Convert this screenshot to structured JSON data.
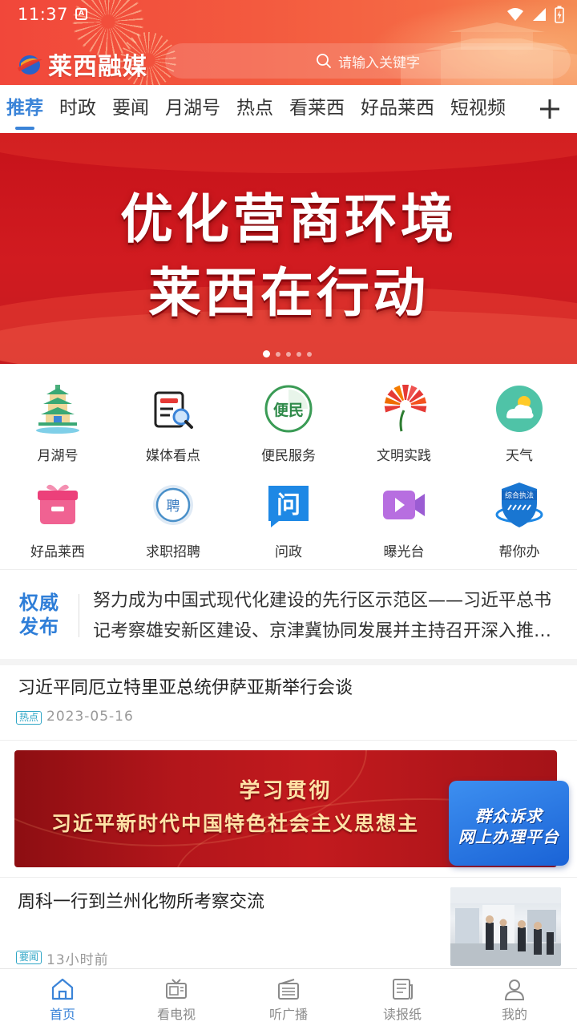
{
  "status_bar": {
    "time": "11:37"
  },
  "header": {
    "logo_text": "莱西融媒",
    "search_placeholder": "请输入关键字"
  },
  "tabs": {
    "items": [
      {
        "label": "推荐",
        "active": true
      },
      {
        "label": "时政"
      },
      {
        "label": "要闻"
      },
      {
        "label": "月湖号"
      },
      {
        "label": "热点"
      },
      {
        "label": "看莱西"
      },
      {
        "label": "好品莱西"
      },
      {
        "label": "短视频"
      }
    ]
  },
  "banner": {
    "line1": "优化营商环境",
    "line2": "莱西在行动",
    "slide_count": 5,
    "current_slide": 1
  },
  "services": [
    {
      "label": "月湖号",
      "icon": "pagoda-icon"
    },
    {
      "label": "媒体看点",
      "icon": "media-document-icon"
    },
    {
      "label": "便民服务",
      "icon": "convenience-service-icon"
    },
    {
      "label": "文明实践",
      "icon": "civilization-flower-icon"
    },
    {
      "label": "天气",
      "icon": "weather-cloud-icon"
    },
    {
      "label": "好品莱西",
      "icon": "gift-box-icon"
    },
    {
      "label": "求职招聘",
      "icon": "recruit-badge-icon"
    },
    {
      "label": "问政",
      "icon": "question-chat-icon"
    },
    {
      "label": "曝光台",
      "icon": "video-camera-icon"
    },
    {
      "label": "帮你办",
      "icon": "law-enforcement-shield-icon"
    }
  ],
  "authority": {
    "tag_line1": "权威",
    "tag_line2": "发布",
    "text": "努力成为中国式现代化建设的先行区示范区——习近平总书记考察雄安新区建设、京津冀协同发展并主持召开深入推进京津冀协同发展座谈会纪实"
  },
  "news": [
    {
      "title": "习近平同厄立特里亚总统伊萨亚斯举行会谈",
      "tag": "热点",
      "date": "2023-05-16"
    },
    {
      "title": "周科一行到兰州化物所考察交流",
      "tag": "要闻",
      "date": "13小时前"
    }
  ],
  "promo": {
    "line1": "学习贯彻",
    "line2": "习近平新时代中国特色社会主义思想主"
  },
  "float_button": {
    "line1": "群众诉求",
    "line2": "网上办理平台"
  },
  "bottom_nav": [
    {
      "label": "首页",
      "icon": "home-icon",
      "active": true
    },
    {
      "label": "看电视",
      "icon": "tv-icon"
    },
    {
      "label": "听广播",
      "icon": "radio-icon"
    },
    {
      "label": "读报纸",
      "icon": "newspaper-icon"
    },
    {
      "label": "我的",
      "icon": "profile-icon"
    }
  ],
  "colors": {
    "accent": "#3b84d8",
    "header_red": "#f1473a",
    "banner_red": "#d11b20",
    "tag_cyan": "#2fa6c6"
  }
}
